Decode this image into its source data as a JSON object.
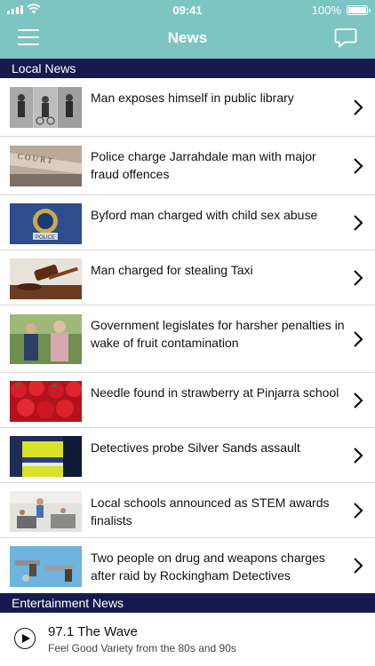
{
  "status_bar": {
    "time": "09:41",
    "battery": "100%"
  },
  "navbar": {
    "title": "News",
    "menu_icon": "hamburger-menu-icon",
    "chat_icon": "chat-bubble-icon"
  },
  "sections": {
    "local": "Local News",
    "entertainment": "Entertainment News"
  },
  "news": [
    {
      "headline": "Man exposes himself in public library",
      "thumb": "cctv-photos"
    },
    {
      "headline": "Police charge Jarrahdale man with major fraud offences",
      "thumb": "court-sign"
    },
    {
      "headline": "Byford man charged with child sex abuse",
      "thumb": "police-badge"
    },
    {
      "headline": "Man charged for stealing Taxi",
      "thumb": "gavel"
    },
    {
      "headline": "Government legislates for harsher penalties in wake of fruit contamination",
      "thumb": "two-men-outdoors"
    },
    {
      "headline": "Needle found in strawberry at Pinjarra school",
      "thumb": "strawberries"
    },
    {
      "headline": "Detectives probe Silver Sands assault",
      "thumb": "police-vest"
    },
    {
      "headline": "Local schools announced as STEM awards finalists",
      "thumb": "classroom"
    },
    {
      "headline": "Two people on drug and weapons charges after raid by Rockingham Detectives",
      "thumb": "seized-guns"
    }
  ],
  "player": {
    "station": "97.1 The Wave",
    "tagline": "Feel Good Variety from the 80s and 90s"
  },
  "colors": {
    "navbar": "#7cc5c3",
    "section_header": "#161a4e"
  }
}
